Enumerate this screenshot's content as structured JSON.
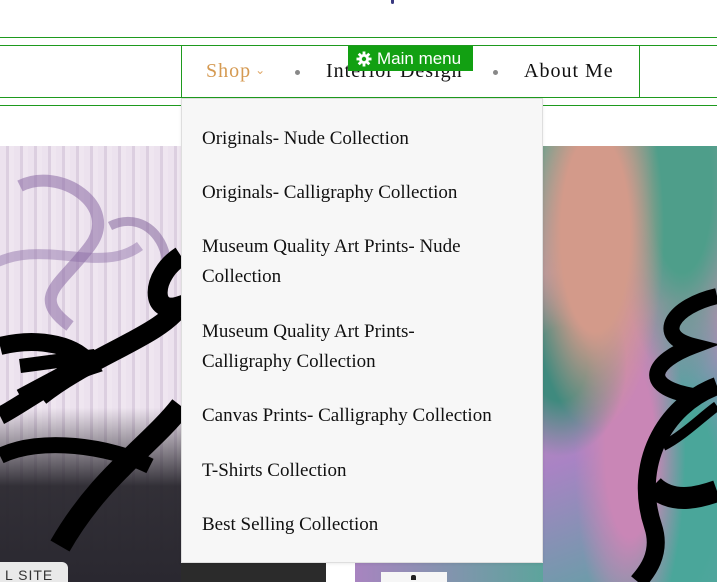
{
  "nav": {
    "items": [
      {
        "label": "Shop",
        "active": true,
        "has_dropdown": true
      },
      {
        "label": "Interior Design"
      },
      {
        "label": "About Me"
      }
    ],
    "chevron_icon": "chevron-down-icon",
    "separator": "•",
    "colors": {
      "border": "#1e9a1e",
      "active": "#d59a52",
      "text": "#111111"
    }
  },
  "main_menu_badge": {
    "label": "Main menu",
    "icon": "gear-icon",
    "bg": "#12a012"
  },
  "dropdown": {
    "items": [
      "Originals- Nude Collection",
      "Originals- Calligraphy Collection",
      "Museum Quality Art Prints- Nude Collection",
      "Museum Quality Art Prints- Calligraphy Collection",
      "Canvas Prints- Calligraphy Collection",
      "T-Shirts Collection",
      "Best Selling Collection"
    ]
  },
  "footer_badge": {
    "label": "L SITE"
  },
  "scroll_top": {
    "icon": "arrow-up-icon"
  }
}
